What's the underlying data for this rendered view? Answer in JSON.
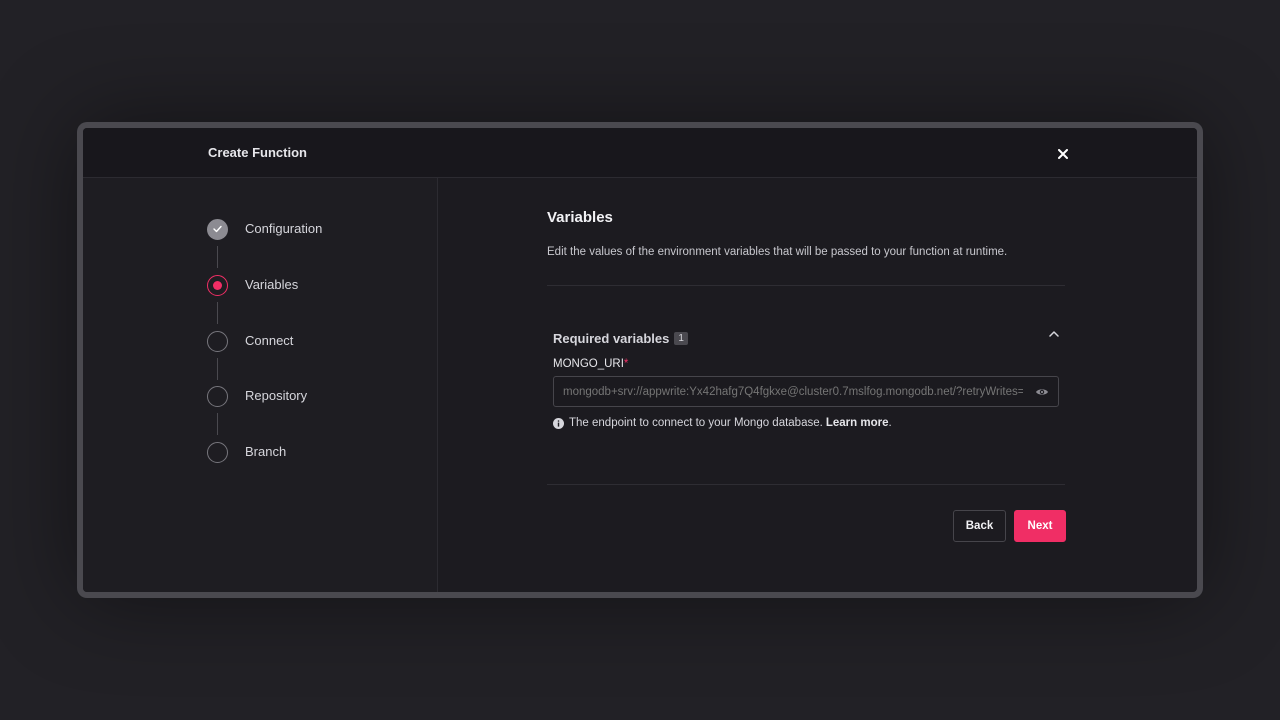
{
  "modal": {
    "title": "Create Function",
    "close_icon": "close-icon"
  },
  "steps": [
    {
      "label": "Configuration",
      "state": "done"
    },
    {
      "label": "Variables",
      "state": "active"
    },
    {
      "label": "Connect",
      "state": "pending"
    },
    {
      "label": "Repository",
      "state": "pending"
    },
    {
      "label": "Branch",
      "state": "pending"
    }
  ],
  "section": {
    "title": "Variables",
    "description": "Edit the values of the environment variables that will be passed to your function at runtime."
  },
  "required_variables": {
    "title": "Required variables",
    "count": "1",
    "expanded": true,
    "variable": {
      "name": "MONGO_URI",
      "required_marker": "*",
      "placeholder": "mongodb+srv://appwrite:Yx42hafg7Q4fgkxe@cluster0.7mslfog.mongodb.net/?retryWrites=true&w=majority",
      "value": "",
      "helper_text": "The endpoint to connect to your Mongo database.",
      "helper_link": "Learn more",
      "helper_suffix": "."
    }
  },
  "buttons": {
    "back": "Back",
    "next": "Next"
  },
  "colors": {
    "accent": "#f02e65",
    "background": "#222126",
    "modal": "#1c1b20"
  }
}
